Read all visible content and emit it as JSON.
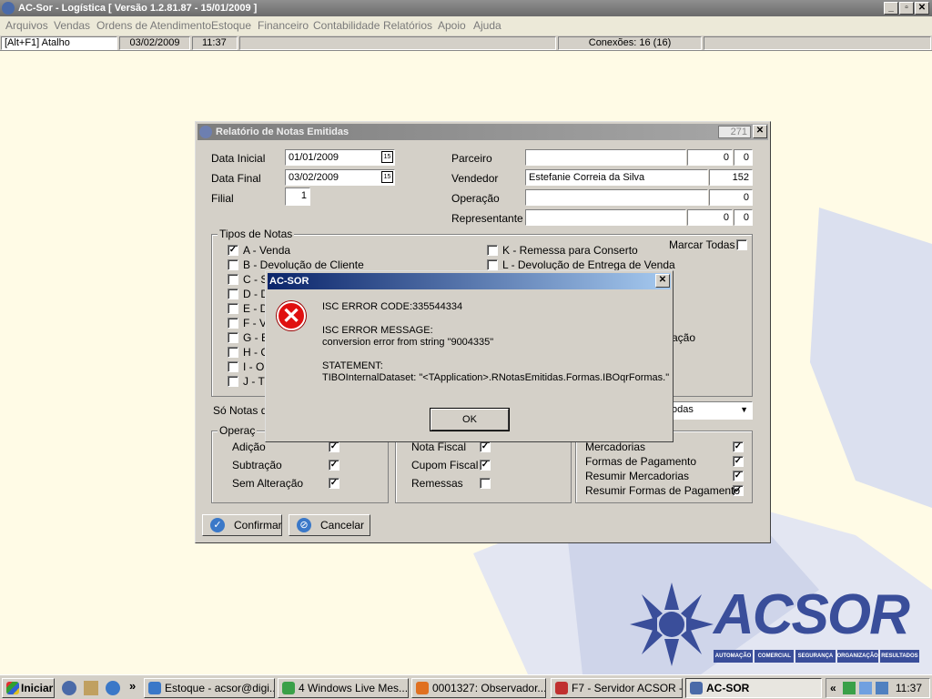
{
  "app": {
    "title": "AC-Sor - Logística  [ Versão 1.2.81.87 - 15/01/2009 ]",
    "min": "_",
    "max": "▫",
    "close": "✕"
  },
  "menu": [
    "Arquivos",
    "Vendas",
    "Ordens de Atendimento",
    "Estoque",
    "Financeiro",
    "Contabilidade",
    "Relatórios",
    "Apoio",
    "Ajuda"
  ],
  "status": {
    "shortcut": "[Alt+F1] Atalho",
    "date": "03/02/2009",
    "time": "11:37",
    "connections": "Conexões: 16 (16)"
  },
  "report": {
    "title": "Relatório de Notas Emitidas",
    "code": "271",
    "close": "✕",
    "data_inicial_label": "Data Inicial",
    "data_inicial": "01/01/2009",
    "data_final_label": "Data Final",
    "data_final": "03/02/2009",
    "filial_label": "Filial",
    "filial": "1",
    "cal_icon": "15",
    "parceiro_label": "Parceiro",
    "parceiro_name": "",
    "parceiro_code": "0",
    "parceiro_code2": "0",
    "vendedor_label": "Vendedor",
    "vendedor_name": "Estefanie Correia da Silva",
    "vendedor_code": "152",
    "operacao_label": "Operação",
    "operacao_name": "",
    "operacao_code": "0",
    "representante_label": "Representante",
    "representante_name": "",
    "representante_code": "0",
    "representante_code2": "0",
    "tipos_label": "Tipos de Notas",
    "marcar_todas": "Marcar Todas",
    "tipos_left": [
      {
        "label": "A - Venda",
        "checked": true
      },
      {
        "label": "B - Devolução de Cliente",
        "checked": false
      },
      {
        "label": "C - S",
        "checked": false
      },
      {
        "label": "D - D",
        "checked": false
      },
      {
        "label": "E - D",
        "checked": false
      },
      {
        "label": "F - V",
        "checked": false
      },
      {
        "label": "G - E",
        "checked": false
      },
      {
        "label": "H - C",
        "checked": false
      },
      {
        "label": "I - Ou",
        "checked": false
      },
      {
        "label": "J - Tr",
        "checked": false
      }
    ],
    "tipos_right": [
      {
        "label": "K - Remessa para Conserto",
        "checked": false
      },
      {
        "label": "L - Devolução de Entrega de Venda",
        "checked": false
      }
    ],
    "tipos_right_partial": "ação",
    "so_notas_label": "Só Notas de",
    "so_notas_select": "odas",
    "operacoes_label": "Operaç",
    "operacoes": [
      {
        "label": "Adição",
        "checked": true
      },
      {
        "label": "Subtração",
        "checked": true
      },
      {
        "label": "Sem Alteração",
        "checked": true
      }
    ],
    "docs": [
      {
        "label": "Nota Fiscal",
        "checked": true
      },
      {
        "label": "Cupom Fiscal",
        "checked": true
      },
      {
        "label": "Remessas",
        "checked": false
      }
    ],
    "resumo": [
      {
        "label": "Mercadorias",
        "checked": true
      },
      {
        "label": "Formas de Pagamento",
        "checked": true
      },
      {
        "label": "Resumir Mercadorias",
        "checked": true
      },
      {
        "label": "Resumir Formas de Pagamento",
        "checked": true
      }
    ],
    "confirm_label": "Confirmar",
    "cancel_label": "Cancelar",
    "confirm_icon": "✓",
    "cancel_icon": "⊘"
  },
  "dialog": {
    "title": "AC-SOR",
    "close": "✕",
    "icon": "✕",
    "line1": "ISC ERROR CODE:335544334",
    "line2": "ISC ERROR MESSAGE:",
    "line3": "conversion error from string \"9004335\"",
    "line4": "STATEMENT:",
    "line5": "TIBOInternalDataset: \"<TApplication>.RNotasEmitidas.Formas.IBOqrFormas.\"",
    "ok_label": "OK"
  },
  "logo": {
    "text": "ACSOR",
    "tags": [
      "AUTOMAÇÃO",
      "COMERCIAL",
      "SEGURANÇA",
      "ORGANIZAÇÃO",
      "RESULTADOS"
    ]
  },
  "taskbar": {
    "start": "Iniciar",
    "more": "»",
    "tasks": [
      {
        "label": "Estoque - acsor@digi...",
        "color": "#3a78c8"
      },
      {
        "label": "4 Windows Live Mes...",
        "color": "#3aa048"
      },
      {
        "label": "0001327: Observador...",
        "color": "#e07020"
      },
      {
        "label": "F7 - Servidor ACSOR -...",
        "color": "#c03030"
      },
      {
        "label": "AC-SOR",
        "color": "#4a6aa8"
      }
    ],
    "tray_arrow": "«",
    "clock": "11:37"
  },
  "colors": {
    "desktop": "#fffbe6",
    "titlebar_inactive": "#7d7d7d",
    "dialog_title": "#0a246a",
    "logo": "#3a4e9a"
  }
}
